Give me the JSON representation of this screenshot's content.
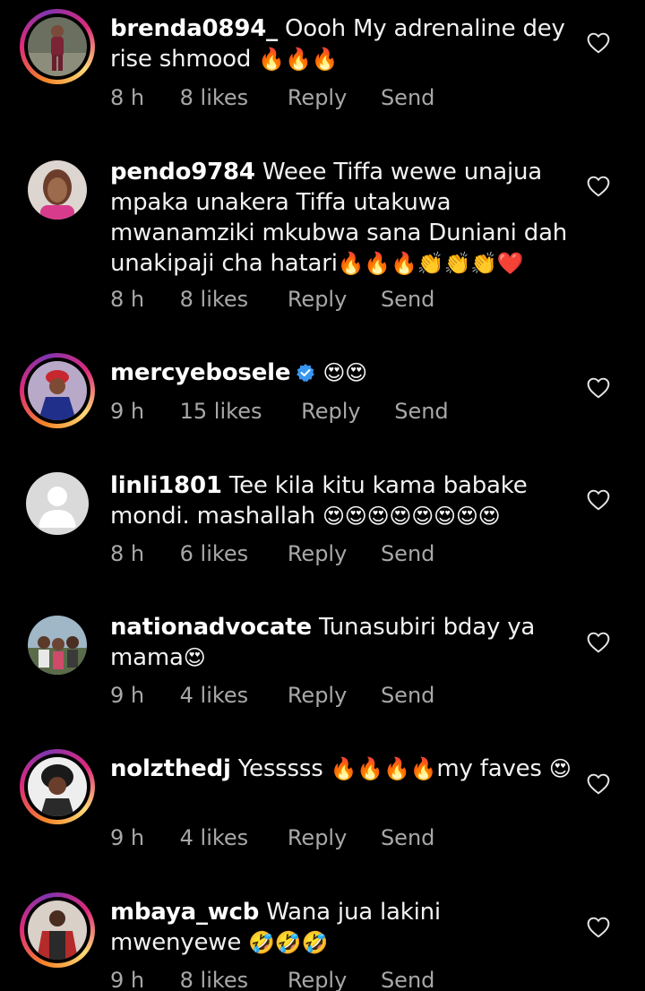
{
  "comments": [
    {
      "username": "brenda0894_",
      "text": "Oooh My adrenaline dey rise shmood",
      "emoji": "🔥🔥🔥",
      "time": "8 h",
      "likes": "8 likes",
      "reply": "Reply",
      "send": "Send",
      "story_ring": true
    },
    {
      "username": "pendo9784",
      "text": "Weee Tiffa wewe unajua mpaka unakera Tiffa utakuwa mwanamziki mkubwa sana Duniani dah unakipaji cha hatari",
      "emoji": "🔥🔥🔥👏👏👏❤️",
      "time": "8 h",
      "likes": "8 likes",
      "reply": "Reply",
      "send": "Send",
      "story_ring": false
    },
    {
      "username": "mercyebosele",
      "text": "",
      "emoji": "😍😍",
      "time": "9 h",
      "likes": "15 likes",
      "reply": "Reply",
      "send": "Send",
      "story_ring": true,
      "verified": true
    },
    {
      "username": "linli1801",
      "text": "Tee kila kitu kama babake mondi. mashallah",
      "emoji": "😍😍😍😍😍😍😍😍",
      "time": "8 h",
      "likes": "6 likes",
      "reply": "Reply",
      "send": "Send",
      "story_ring": false
    },
    {
      "username": "nationadvocate",
      "text": "Tunasubiri bday ya mama",
      "emoji": "😍",
      "time": "9 h",
      "likes": "4 likes",
      "reply": "Reply",
      "send": "Send",
      "story_ring": false
    },
    {
      "username": "nolzthedj",
      "text": "Yesssss",
      "emoji": "🔥🔥🔥🔥",
      "text_after": "my faves",
      "emoji_after": "😍",
      "time": "9 h",
      "likes": "4 likes",
      "reply": "Reply",
      "send": "Send",
      "story_ring": true
    },
    {
      "username": "mbaya_wcb",
      "text": "Wana jua lakini mwenyewe",
      "emoji": "🤣🤣🤣",
      "time": "9 h",
      "likes": "8 likes",
      "reply": "Reply",
      "send": "Send",
      "story_ring": true
    }
  ],
  "colors": {
    "background": "#000000",
    "text": "#f5f5f5",
    "meta": "#a8a8a8",
    "verified": "#3897f0"
  },
  "icons": {
    "like": "heart-outline-icon",
    "verified": "verified-badge-icon"
  }
}
